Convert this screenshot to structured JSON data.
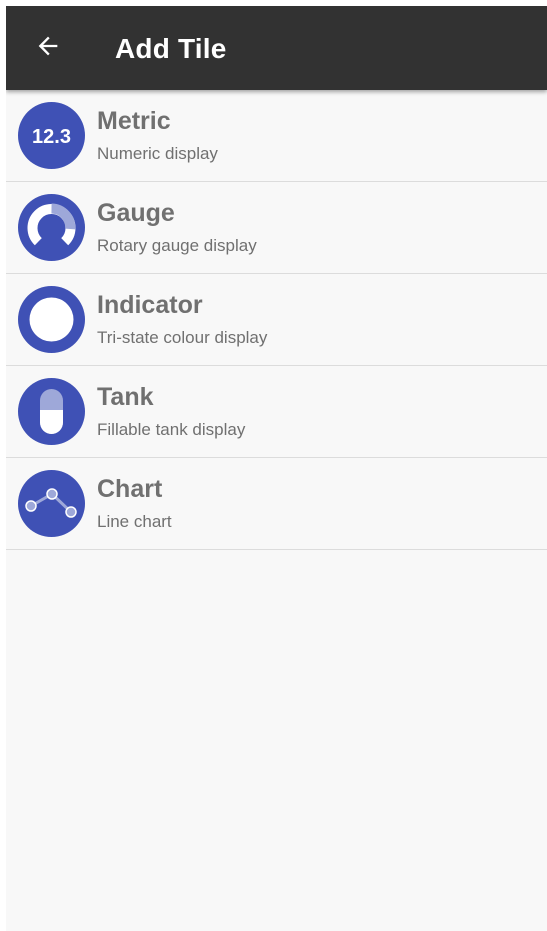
{
  "colors": {
    "appbar": "#323232",
    "accent": "#3f51b5",
    "accent_light": "#9ea8d9",
    "text_secondary": "#707070",
    "background": "#f8f8f8",
    "divider": "#dcdcdc"
  },
  "appbar": {
    "back_icon": "arrow-left-icon",
    "title": "Add Tile"
  },
  "tiles": [
    {
      "icon": "metric-icon",
      "icon_text": "12.3",
      "title": "Metric",
      "subtitle": "Numeric display"
    },
    {
      "icon": "gauge-icon",
      "title": "Gauge",
      "subtitle": "Rotary gauge display"
    },
    {
      "icon": "indicator-icon",
      "title": "Indicator",
      "subtitle": "Tri-state colour display"
    },
    {
      "icon": "tank-icon",
      "title": "Tank",
      "subtitle": "Fillable tank display"
    },
    {
      "icon": "chart-icon",
      "title": "Chart",
      "subtitle": "Line chart"
    }
  ]
}
